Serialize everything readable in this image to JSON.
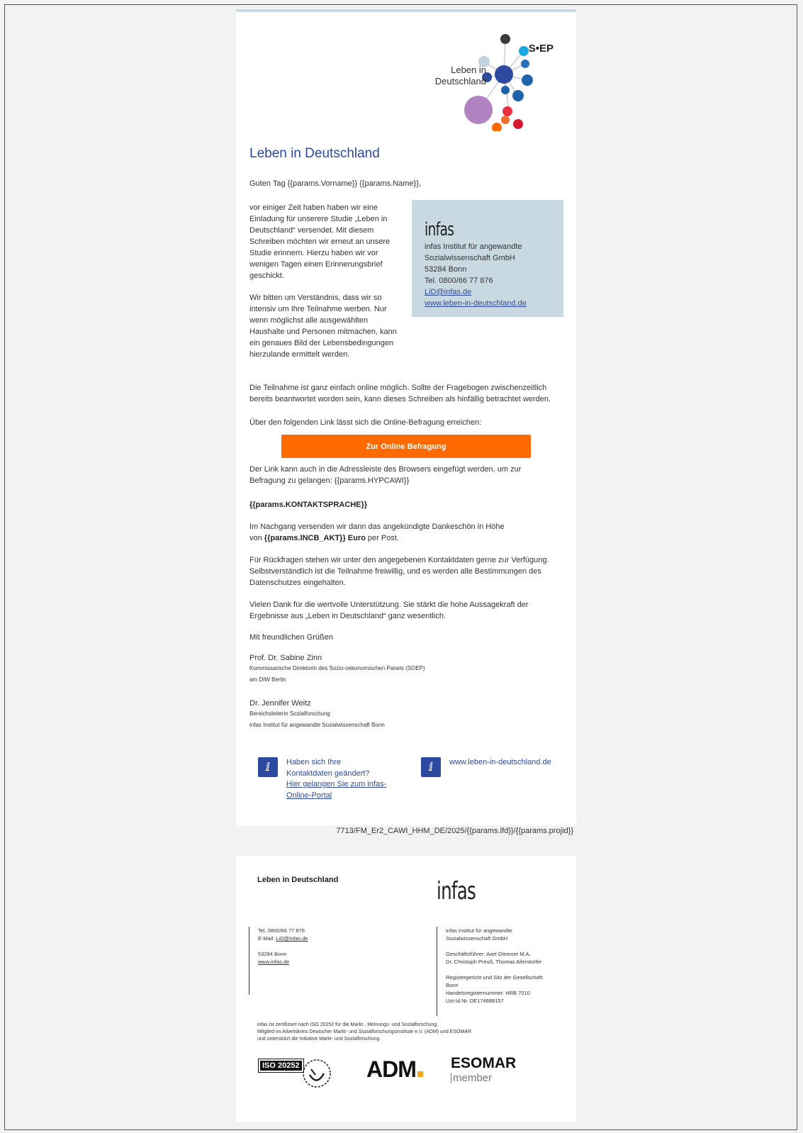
{
  "brand": {
    "logo_text": "Leben in Deutschland",
    "soep": "S•EP",
    "infas": "infas"
  },
  "main": {
    "title": "Leben in Deutschland",
    "greeting": "Guten Tag {{params.Vorname}} {{params.Name}},",
    "para1": "vor einiger Zeit haben haben wir eine Einladung für unserere Studie „Leben in Deutschland“ versendet. Mit diesem Schreiben möchten wir erneut an unsere Studie erinnern. Hierzu haben wir vor wenigen Tagen einen Erinnerungsbrief geschickt.",
    "para2": "Wir bitten um Verständnis, dass wir so intensiv um Ihre Teilnahme werben. Nur wenn möglichst alle ausgewählten Haushalte und Personen mitmachen, kann ein genaues Bild der Lebensbedingungen hierzulande ermittelt werden.",
    "para3": "Die Teilnahme ist ganz einfach online möglich. Sollte der Fragebogen zwischenzeitlich bereits beantwortet worden sein, kann dieses Schreiben als hinfällig betrachtet werden.",
    "para4": "Über den folgenden Link lässt sich die Online-Befragung erreichen:",
    "cta_label": "Zur Online Befragung",
    "para5": "Der Link kann auch in die Adressleiste des Browsers eingefügt werden, um zur Befragung zu gelangen: {{params.HYPCAWI}}",
    "kontaktsprache": "{{params.KONTAKTSPRACHE}}",
    "para6_a": "Im Nachgang versenden wir dann das angekündigte Dankeschön in Höhe",
    "para6_b": "von ",
    "para6_bold": "{{params.INCB_AKT}} Euro",
    "para6_c": " per Post.",
    "para7": "Für Rückfragen stehen wir unter den angegebenen Kontaktdaten gerne zur Verfügung. Selbstverständlich ist die Teilnahme freiwillig, und es werden alle Bestimmungen des Datenschutzes eingehalten.",
    "para8": "Vielen Dank für die wertvolle Unterstützung. Sie stärkt die hohe Aussagekraft der Ergebnisse aus „Leben in Deutschland“ ganz wesentlich.",
    "closing": "Mit freundlichen Grüßen",
    "sig1_name": "Prof. Dr. Sabine Zinn",
    "sig1_role": "Kommissarische Direktorin des Sozio-oekonomischen Panels (SOEP)",
    "sig1_org": "am DIW Berlin",
    "sig2_name": "Dr. Jennifer Weitz",
    "sig2_role": "Bereichsleiterin Sozialforschung",
    "sig2_org": "infas Institut für angewandte Sozialwissenschaft Bonn"
  },
  "infobox": {
    "line1": "infas Institut für angewandte",
    "line2": "Sozialwissenschaft GmbH",
    "line3": "53284 Bonn",
    "line4": "Tel. 0800/66 77 876",
    "email": "LiD@infas.de",
    "web": "www.leben-in-deutschland.de"
  },
  "links": {
    "contact_q1": "Haben sich Ihre",
    "contact_q2": "Kontaktdaten geändert?",
    "portal_link1": "Hier gelangen Sie zum infas-",
    "portal_link2": "Online-Portal",
    "website": "www.leben-in-deutschland.de"
  },
  "reference": "7713/FM_Er2_CAWI_HHM_DE/2025/{{params.lfd}}/{{params.projid}}",
  "footer": {
    "title": "Leben in Deutschland",
    "tel": "Tel. 0800/66 77 876",
    "email_label": "E-Mail: ",
    "email": "LiD@infas.de",
    "city": "53284 Bonn",
    "web": "www.infas.de",
    "org1": "infas Institut für angewandte",
    "org2": "Sozialwissenschaft GmbH",
    "gf_label": "Geschäftsführer: Axel Glemser M.A,",
    "gf_names": "Dr. Christoph Preuß, Thomas Allerstorfer",
    "reg1": "Registergericht und Sitz der Gesellschaft:",
    "reg2": "Bonn",
    "reg3": "Handelsregisternummer: HRB 7010",
    "reg4": "Ust-Id.Nr. DE174688157",
    "cert1": "infas ist zertifiziert nach ISO 20252 für die Markt-, Meinungs- und Sozialforschung,",
    "cert2": "Mitglied im Arbeitskreis Deutscher Markt- und Sozialforschungsinstitute e.V. (ADM) und ESOMAR",
    "cert3": "und unterstützt die Initiative Markt- und Sozialforschung.",
    "iso_badge": "ISO 20252",
    "adm": "ADM",
    "esomar": "ESOMAR",
    "esomar_sub": "member"
  },
  "colors": {
    "accent_blue": "#2e4aa0",
    "cta_orange": "#ff6a00",
    "infobox_bg": "#c8d9e2"
  }
}
